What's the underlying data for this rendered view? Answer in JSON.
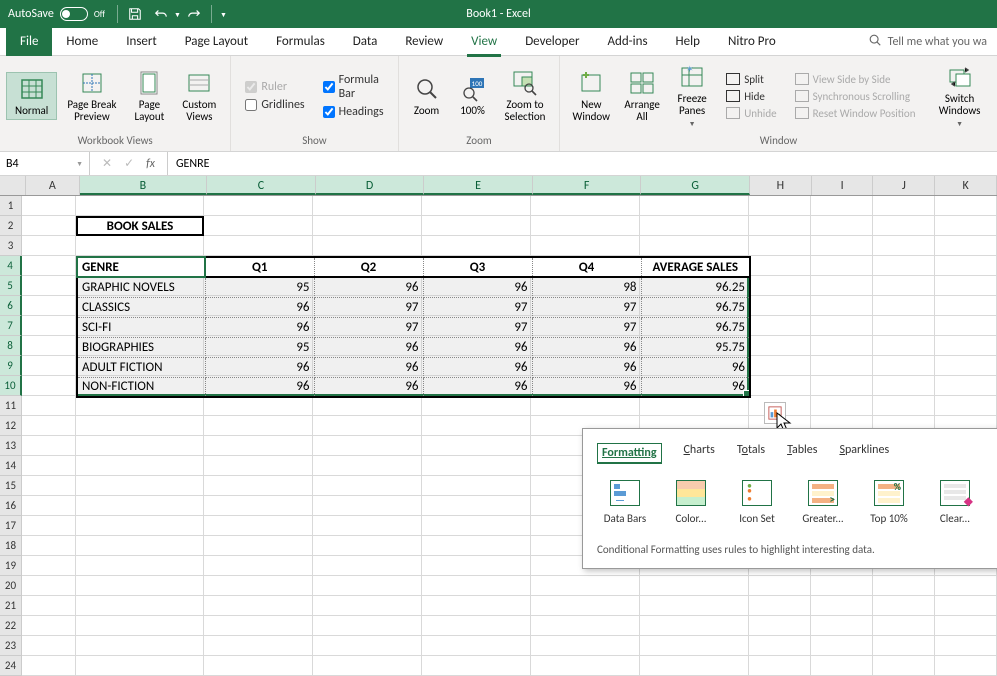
{
  "titlebar": {
    "autosave_label": "AutoSave",
    "autosave_state": "Off",
    "title": "Book1 - Excel"
  },
  "tabs": {
    "file": "File",
    "home": "Home",
    "insert": "Insert",
    "page_layout": "Page Layout",
    "formulas": "Formulas",
    "data": "Data",
    "review": "Review",
    "view": "View",
    "developer": "Developer",
    "addins": "Add-ins",
    "help": "Help",
    "nitro": "Nitro Pro",
    "tell_me": "Tell me what you wa"
  },
  "ribbon": {
    "workbook_views": {
      "normal": "Normal",
      "page_break": "Page Break\nPreview",
      "page_layout": "Page\nLayout",
      "custom_views": "Custom\nViews",
      "group": "Workbook Views"
    },
    "show": {
      "ruler": "Ruler",
      "formula_bar": "Formula Bar",
      "gridlines": "Gridlines",
      "headings": "Headings",
      "group": "Show"
    },
    "zoom": {
      "zoom": "Zoom",
      "hundred": "100%",
      "zoom_to_sel": "Zoom to\nSelection",
      "group": "Zoom"
    },
    "window": {
      "new_window": "New\nWindow",
      "arrange_all": "Arrange\nAll",
      "freeze": "Freeze\nPanes",
      "split": "Split",
      "hide": "Hide",
      "unhide": "Unhide",
      "side_by_side": "View Side by Side",
      "sync_scroll": "Synchronous Scrolling",
      "reset_pos": "Reset Window Position",
      "switch": "Switch\nWindows",
      "group": "Window"
    }
  },
  "formula_bar": {
    "name_box": "B4",
    "fx": "fx",
    "value": "GENRE"
  },
  "columns": [
    "A",
    "B",
    "C",
    "D",
    "E",
    "F",
    "G",
    "H",
    "I",
    "J",
    "K"
  ],
  "merged_title": "BOOK SALES",
  "table": {
    "headers": [
      "GENRE",
      "Q1",
      "Q2",
      "Q3",
      "Q4",
      "AVERAGE SALES"
    ],
    "rows": [
      {
        "genre": "GRAPHIC NOVELS",
        "q1": 95,
        "q2": 96,
        "q3": 96,
        "q4": 98,
        "avg": "96.25"
      },
      {
        "genre": "CLASSICS",
        "q1": 96,
        "q2": 97,
        "q3": 97,
        "q4": 97,
        "avg": "96.75"
      },
      {
        "genre": "SCI-FI",
        "q1": 96,
        "q2": 97,
        "q3": 97,
        "q4": 97,
        "avg": "96.75"
      },
      {
        "genre": "BIOGRAPHIES",
        "q1": 95,
        "q2": 96,
        "q3": 96,
        "q4": 96,
        "avg": "95.75"
      },
      {
        "genre": "ADULT FICTION",
        "q1": 96,
        "q2": 96,
        "q3": 96,
        "q4": 96,
        "avg": "96"
      },
      {
        "genre": "NON-FICTION",
        "q1": 96,
        "q2": 96,
        "q3": 96,
        "q4": 96,
        "avg": "96"
      }
    ]
  },
  "popup": {
    "tabs": {
      "formatting": "Formatting",
      "charts": "Charts",
      "totals": "Totals",
      "tables": "Tables",
      "sparklines": "Sparklines"
    },
    "items": {
      "databars": "Data Bars",
      "colorscale": "Color...",
      "iconset": "Icon Set",
      "greater": "Greater...",
      "top10": "Top 10%",
      "clear": "Clear..."
    },
    "hint": "Conditional Formatting uses rules to highlight interesting data."
  }
}
